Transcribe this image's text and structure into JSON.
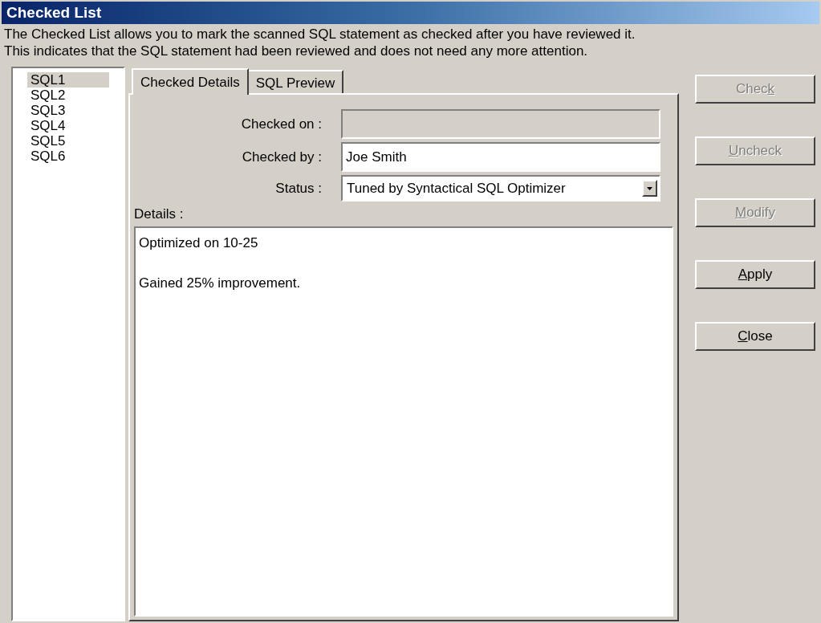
{
  "window": {
    "title": "Checked List"
  },
  "description": [
    "The Checked List allows you to mark the scanned SQL statement as checked after you have reviewed it.",
    "This indicates that the SQL statement had been reviewed and does not need any more attention."
  ],
  "sql_list": [
    {
      "label": "SQL1",
      "selected": true
    },
    {
      "label": "SQL2",
      "selected": false
    },
    {
      "label": "SQL3",
      "selected": false
    },
    {
      "label": "SQL4",
      "selected": false
    },
    {
      "label": "SQL5",
      "selected": false
    },
    {
      "label": "SQL6",
      "selected": false
    }
  ],
  "tabs": [
    {
      "label": "Checked Details",
      "selected": true
    },
    {
      "label": "SQL Preview",
      "selected": false
    }
  ],
  "form": {
    "checked_on": {
      "label": "Checked on :",
      "disabled": true
    },
    "checked_by": {
      "label": "Checked by :",
      "value": "Joe Smith"
    },
    "status": {
      "label": "Status :",
      "value": "Tuned by Syntactical SQL Optimizer"
    },
    "details": {
      "label": "Details :",
      "paragraphs": [
        "Optimized on 10-25",
        "Gained 25% improvement."
      ]
    }
  },
  "buttons": [
    {
      "pre": "Chec",
      "key": "k",
      "disabled": true
    },
    {
      "key": "U",
      "post": "ncheck",
      "disabled": true
    },
    {
      "key": "M",
      "post": "odify",
      "disabled": true
    },
    {
      "key": "A",
      "post": "pply",
      "disabled": false
    },
    {
      "key": "C",
      "post": "lose",
      "disabled": false
    }
  ]
}
